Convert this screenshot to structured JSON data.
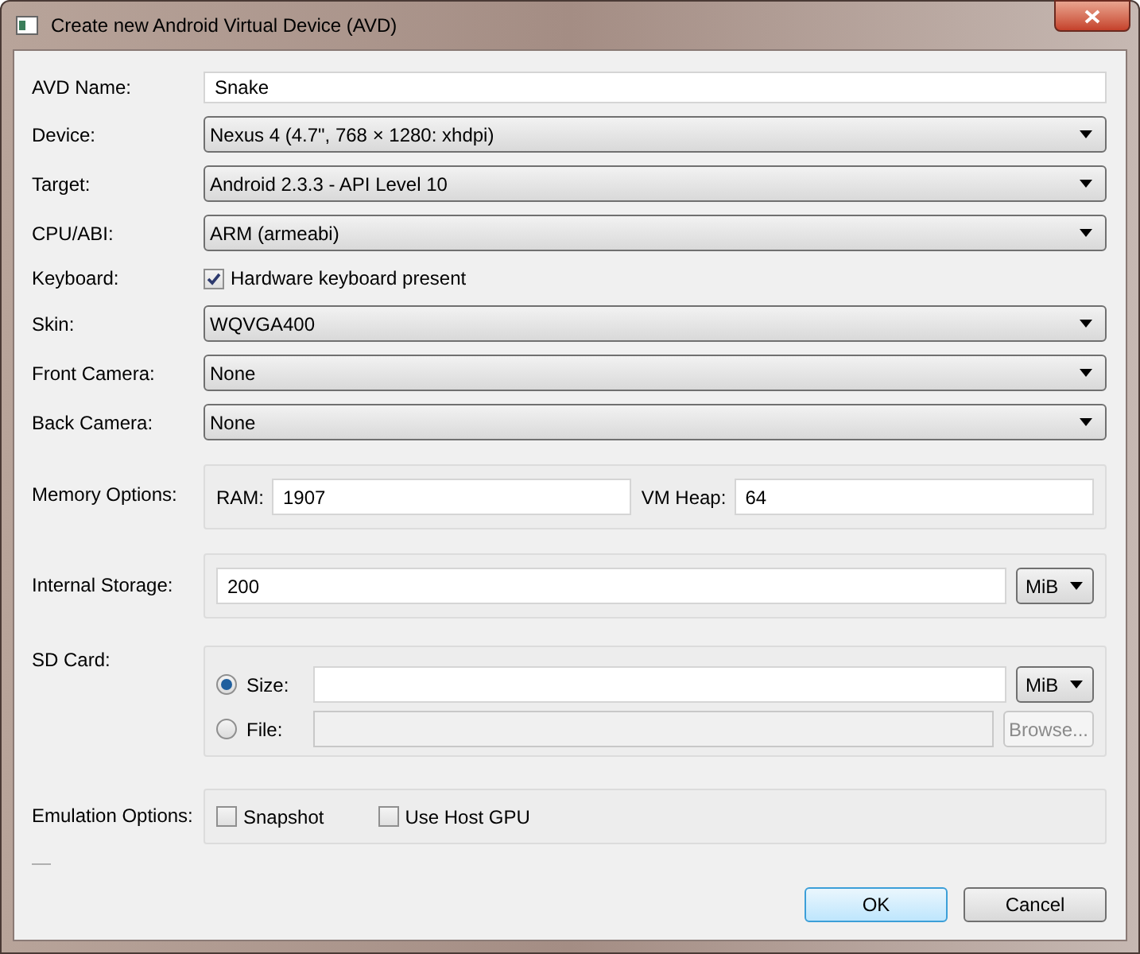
{
  "window": {
    "title": "Create new Android Virtual Device (AVD)"
  },
  "fields": [
    {
      "kind": "text",
      "label": "AVD Name:",
      "value": "Snake"
    },
    {
      "kind": "dropdown",
      "label": "Device:",
      "value": "Nexus 4 (4.7\", 768 × 1280: xhdpi)"
    },
    {
      "kind": "dropdown",
      "label": "Target:",
      "value": "Android 2.3.3 - API Level 10"
    },
    {
      "kind": "dropdown",
      "label": "CPU/ABI:",
      "value": "ARM (armeabi)"
    },
    {
      "kind": "checkbox",
      "label": "Keyboard:",
      "value": "Hardware keyboard present",
      "checked": true
    },
    {
      "kind": "dropdown",
      "label": "Skin:",
      "value": "WQVGA400"
    },
    {
      "kind": "dropdown",
      "label": "Front Camera:",
      "value": "None"
    },
    {
      "kind": "dropdown",
      "label": "Back Camera:",
      "value": "None"
    }
  ],
  "memory": {
    "label": "Memory Options:",
    "ram": {
      "label": "RAM:",
      "value": "1907"
    },
    "vm_heap": {
      "label": "VM Heap:",
      "value": "64"
    }
  },
  "internal_storage": {
    "label": "Internal Storage:",
    "value": "200",
    "unit": "MiB"
  },
  "sd_card": {
    "label": "SD Card:",
    "options": [
      {
        "kind": "size",
        "label": "Size:",
        "selected": true,
        "disabled": false,
        "unit": "MiB"
      },
      {
        "kind": "file",
        "label": "File:",
        "selected": false,
        "disabled": true,
        "button": "Browse..."
      }
    ]
  },
  "emulation": {
    "label": "Emulation Options:",
    "options": [
      {
        "label": "Snapshot",
        "checked": false
      },
      {
        "label": "Use Host GPU",
        "checked": false
      }
    ]
  },
  "buttons": [
    {
      "label": "OK",
      "default": true
    },
    {
      "label": "Cancel",
      "default": false
    }
  ]
}
